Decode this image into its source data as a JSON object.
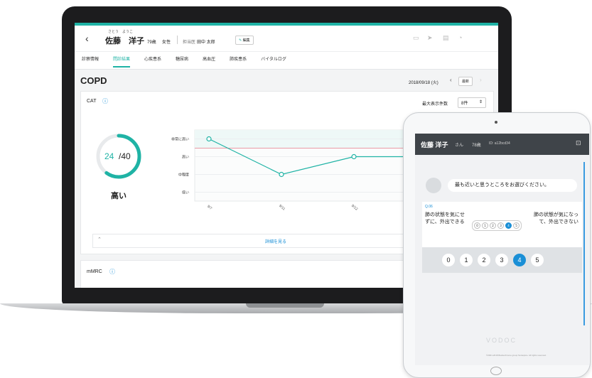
{
  "patient": {
    "furigana": "さとう　ようこ",
    "name": "佐藤　洋子",
    "age": "79歳",
    "gender": "女性",
    "doctor_label": "担当医",
    "doctor": "田中 太郎",
    "edit_label": "編集"
  },
  "nav_tabs": [
    "診察情報",
    "問診結果",
    "心疾患系",
    "糖尿病",
    "高血圧",
    "肺疾患系",
    "バイタルログ"
  ],
  "active_tab": 1,
  "section_title": "COPD",
  "date": "2018/09/18 (火)",
  "latest_label": "最新",
  "cat": {
    "title": "CAT",
    "max_display_label": "最大表示件数",
    "max_display_value": "8件",
    "score": "24",
    "score_max": "/40",
    "level": "高い",
    "detail_label": "詳細を見る"
  },
  "mmrc_title": "mMRC",
  "chart_data": {
    "type": "line",
    "y_categories": [
      "低い",
      "中程度",
      "高い",
      "非常に高い"
    ],
    "x": [
      "9/7",
      "9/11",
      "9/12"
    ],
    "values": [
      4,
      2,
      3
    ],
    "accent": "#1fb3a5",
    "threshold_color": "#e57b8a"
  },
  "tablet": {
    "name": "佐藤 洋子",
    "honorific": "さん",
    "age": "78歳",
    "id": "ID: a12bcd34",
    "prompt": "最も近いと思うところをお選びください。",
    "question_no": "Q.06",
    "left_text": "肺の状態を気にせずに、外出できる",
    "right_text": "肺の状態が気になって、外出できない",
    "options": [
      "0",
      "1",
      "2",
      "3",
      "4",
      "5"
    ],
    "selected": 4,
    "brand": "VODOC",
    "copyright": "©2001-2018 Bustlechrome group Soraspice. All rights reserved."
  },
  "colors": {
    "accent": "#1fb3a5",
    "selected": "#1a8fd6"
  }
}
